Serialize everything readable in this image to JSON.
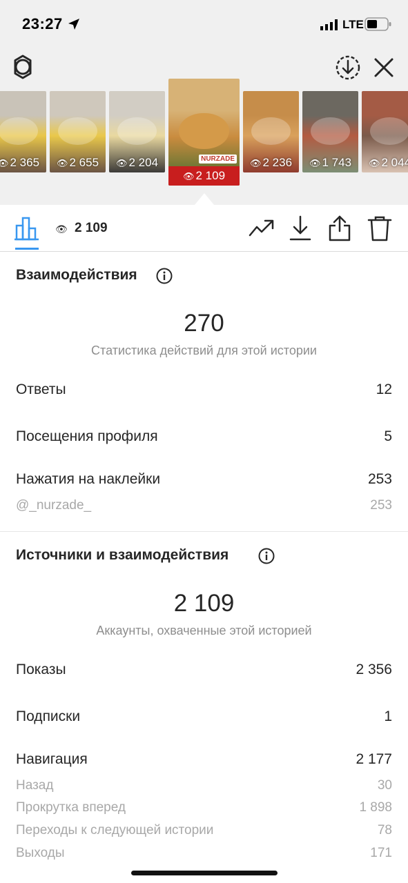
{
  "status_bar": {
    "time": "23:27",
    "network": "LTE"
  },
  "thumbnails": [
    {
      "views": "2 365",
      "colors": [
        "#c9c3b8",
        "#e8c64a",
        "#6b5444"
      ]
    },
    {
      "views": "2 655",
      "colors": [
        "#cfc8bc",
        "#e9c84b",
        "#6b5444"
      ]
    },
    {
      "views": "2 204",
      "colors": [
        "#d2cdc4",
        "#e9d9a0",
        "#3c3a38"
      ]
    },
    {
      "views": "2 109",
      "active": true,
      "badge": "NURZADE",
      "colors": [
        "#d7b276",
        "#c98b3e",
        "#3a6b2f"
      ]
    },
    {
      "views": "2 236",
      "colors": [
        "#c68d4a",
        "#d9a15c",
        "#8f3b2e"
      ]
    },
    {
      "views": "1 743",
      "colors": [
        "#6c6860",
        "#b35b42",
        "#7d8e74"
      ]
    },
    {
      "views": "2 044",
      "colors": [
        "#a45b45",
        "#7a5a4a",
        "#d9c2b2"
      ]
    }
  ],
  "icon_bar": {
    "views": "2 109"
  },
  "interactions": {
    "title": "Взаимодействия",
    "total": "270",
    "caption": "Статистика действий для этой истории",
    "rows": [
      {
        "label": "Ответы",
        "value": "12"
      },
      {
        "label": "Посещения профиля",
        "value": "5"
      },
      {
        "label": "Нажатия на наклейки",
        "value": "253"
      }
    ],
    "sub_rows": [
      {
        "label": "@_nurzade_",
        "value": "253"
      }
    ]
  },
  "sources": {
    "title": "Источники и взаимодействия",
    "total": "2 109",
    "caption": "Аккаунты, охваченные этой историей",
    "rows": [
      {
        "label": "Показы",
        "value": "2 356"
      },
      {
        "label": "Подписки",
        "value": "1"
      },
      {
        "label": "Навигация",
        "value": "2 177"
      }
    ],
    "sub_rows": [
      {
        "label": "Назад",
        "value": "30"
      },
      {
        "label": "Прокрутка вперед",
        "value": "1 898"
      },
      {
        "label": "Переходы к следующей истории",
        "value": "78"
      },
      {
        "label": "Выходы",
        "value": "171"
      }
    ]
  },
  "colors": {
    "accent": "#3897f0",
    "active_badge": "#c81e1e",
    "text_primary": "#262626",
    "text_secondary": "#8e8e8e"
  }
}
